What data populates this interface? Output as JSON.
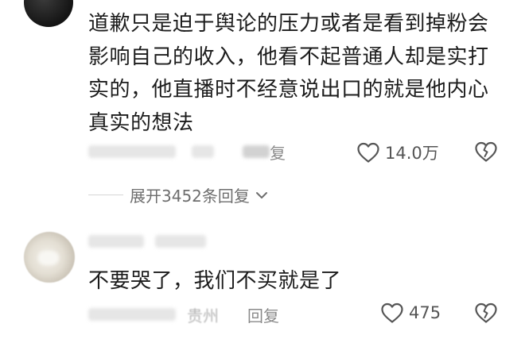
{
  "comment1": {
    "text": "道歉只是迫于舆论的压力或者是看到掉粉会影响自己的收入，他看不起普通人却是实打实的，他直播时不经意说出口的就是他内心真实的想法",
    "reply_label": "复",
    "likes": "14.0万",
    "like_icon": "heart-outline-icon",
    "dislike_icon": "broken-heart-icon"
  },
  "expand": {
    "label": "展开3452条回复",
    "chevron_icon": "chevron-down-icon"
  },
  "comment2": {
    "text": "不要哭了，我们不买就是了",
    "location_partial": "贵州",
    "reply_label": "回复",
    "likes": "475",
    "like_icon": "heart-outline-icon",
    "dislike_icon": "broken-heart-icon"
  },
  "colors": {
    "text": "#1c1c1c",
    "meta": "#8a8a8a",
    "icon": "#555555",
    "background": "#ffffff"
  }
}
